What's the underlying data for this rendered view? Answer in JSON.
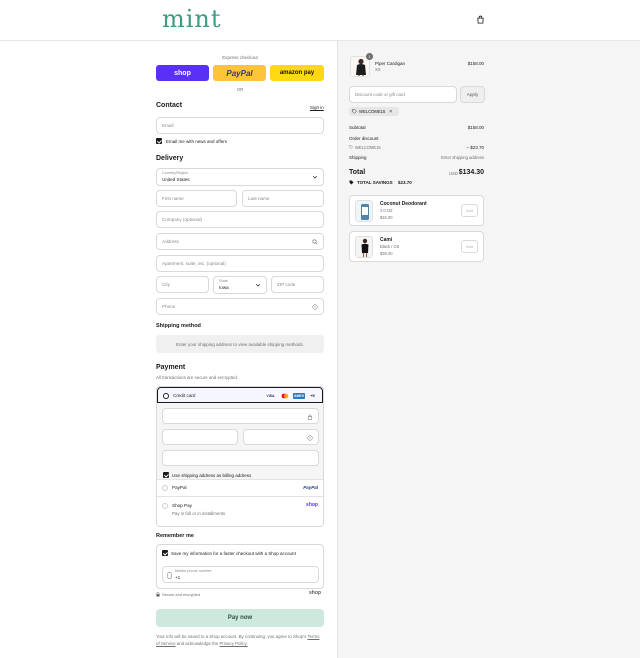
{
  "header": {
    "logo": "mint",
    "cart_icon": "shopping-bag-icon"
  },
  "express": {
    "label": "Express checkout",
    "shop": "shop",
    "paypal": "PayPal",
    "amazon": "amazon pay",
    "or": "OR"
  },
  "contact": {
    "title": "Contact",
    "sign_in": "Sign in",
    "email_placeholder": "Email",
    "news_label": "Email me with news and offers"
  },
  "delivery": {
    "title": "Delivery",
    "country_label": "Country/Region",
    "country_value": "United States",
    "first_name": "First name",
    "last_name": "Last name",
    "company": "Company (optional)",
    "address": "Address",
    "apartment": "Apartment, suite, etc. (optional)",
    "city": "City",
    "state_label": "State",
    "state_value": "Iowa",
    "zip": "ZIP code",
    "phone": "Phone"
  },
  "shipping": {
    "title": "Shipping method",
    "notice": "Enter your shipping address to view available shipping methods."
  },
  "payment": {
    "title": "Payment",
    "subtitle": "All transactions are secure and encrypted.",
    "credit_card": "Credit card",
    "cards": [
      "VISA",
      "MC",
      "AMEX",
      "+5"
    ],
    "billing_label": "Use shipping address as billing address",
    "paypal": "PayPal",
    "paypal_logo": "PayPal",
    "shop_pay": "Shop Pay",
    "shop_pay_sub": "Pay in full or in installments",
    "shop_logo": "shop"
  },
  "remember": {
    "title": "Remember me",
    "save_label": "Save my information for a faster checkout with a Shop account",
    "phone_label": "Mobile phone number",
    "phone_value": "+1",
    "secure": "Secure and encrypted",
    "shop_logo": "shop"
  },
  "pay_now": "Pay now",
  "legal": {
    "text": "Your info will be saved to a Shop account. By continuing, you agree to Shop's",
    "terms": "Terms of Service",
    "and": "and acknowledge the",
    "privacy": "Privacy Policy."
  },
  "order": {
    "item_name": "Piper Cardigan",
    "item_variant": "XS",
    "item_price": "$158.00",
    "item_qty": "1",
    "discount_placeholder": "Discount code or gift card",
    "apply": "Apply",
    "tag": "WELCOME15",
    "subtotal_label": "Subtotal",
    "subtotal_value": "$158.00",
    "order_discount_label": "Order discount",
    "discount_code": "WELCOME15",
    "discount_value": "– $23.70",
    "shipping_label": "Shipping",
    "shipping_value": "Enter shipping address",
    "total_label": "Total",
    "currency": "USD",
    "total_value": "$134.30",
    "savings_label": "TOTAL SAVINGS",
    "savings_value": "$23.70"
  },
  "upsells": [
    {
      "name": "Coconut Deodorant",
      "variant": "2.0 OZ",
      "price": "$15.00",
      "add": "Add"
    },
    {
      "name": "Cami",
      "variant": "Black / OS",
      "price": "$38.00",
      "add": "Add"
    }
  ],
  "colors": {
    "brand": "#3e9b82",
    "shop": "#5a31f4",
    "paypal": "#ffc439",
    "amazon": "#ffd814",
    "pay_now": "#cde8dc"
  }
}
